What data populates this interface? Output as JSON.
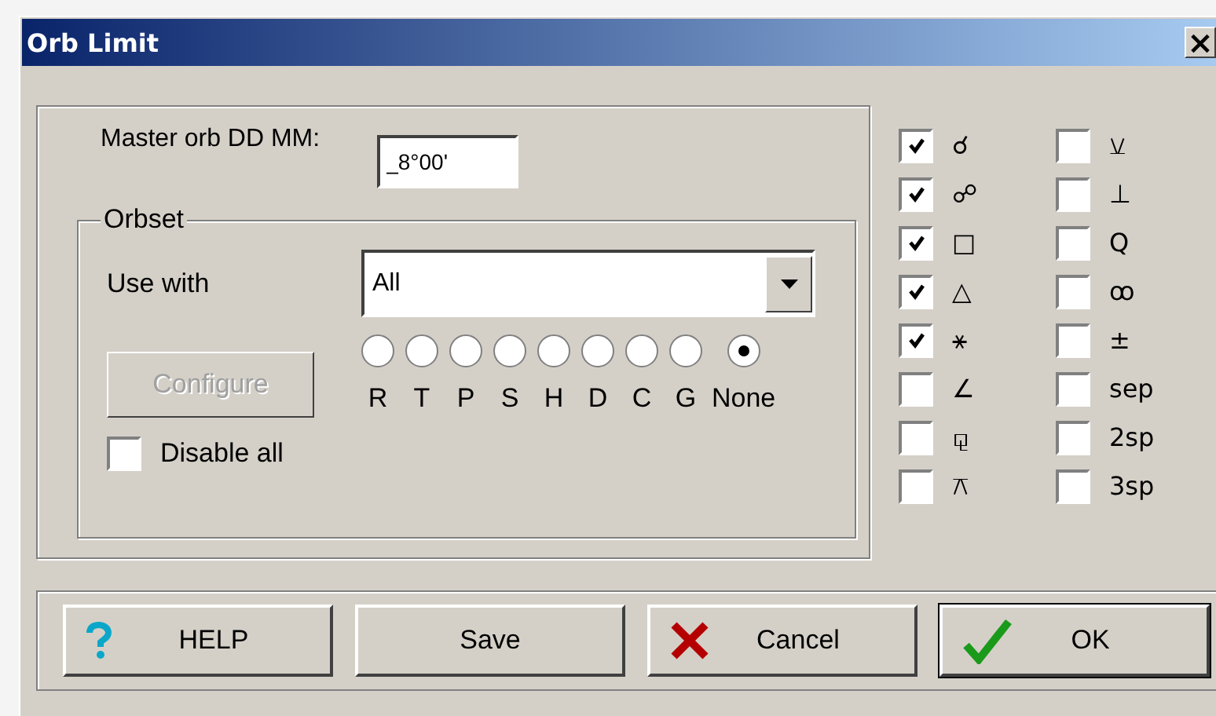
{
  "window": {
    "title": "Orb Limit",
    "close": "×"
  },
  "master_orb": {
    "label": "Master orb DD MM:",
    "value": "_8°00'"
  },
  "orbset": {
    "title": "Orbset",
    "use_with_label": "Use with",
    "use_with_value": "All",
    "configure": {
      "label": "Configure",
      "disabled": true
    },
    "radios": [
      {
        "label": "R",
        "selected": false
      },
      {
        "label": "T",
        "selected": false
      },
      {
        "label": "P",
        "selected": false
      },
      {
        "label": "S",
        "selected": false
      },
      {
        "label": "H",
        "selected": false
      },
      {
        "label": "D",
        "selected": false
      },
      {
        "label": "C",
        "selected": false
      },
      {
        "label": "G",
        "selected": false
      },
      {
        "label": "None",
        "selected": true
      }
    ],
    "disable_all": {
      "label": "Disable all",
      "checked": false
    }
  },
  "aspects": [
    {
      "symbol": "☌",
      "checked": true
    },
    {
      "symbol": "☍",
      "checked": true
    },
    {
      "symbol": "□",
      "checked": true
    },
    {
      "symbol": "△",
      "checked": true
    },
    {
      "symbol": "⚹",
      "checked": true
    },
    {
      "symbol": "∠",
      "checked": false
    },
    {
      "symbol": "⚼",
      "checked": false
    },
    {
      "symbol": "⚻",
      "checked": false
    },
    {
      "symbol": "⚺",
      "checked": false
    },
    {
      "symbol": "⊥",
      "checked": false
    },
    {
      "symbol": "Q",
      "checked": false
    },
    {
      "symbol": "ꝏ",
      "checked": false
    },
    {
      "symbol": "±",
      "checked": false
    },
    {
      "symbol": "sep",
      "checked": false
    },
    {
      "symbol": "2sp",
      "checked": false
    },
    {
      "symbol": "3sp",
      "checked": false
    }
  ],
  "buttons": [
    {
      "kind": "help",
      "label": "HELP"
    },
    {
      "kind": "save",
      "label": "Save"
    },
    {
      "kind": "cancel",
      "label": "Cancel"
    },
    {
      "kind": "ok",
      "label": "OK"
    }
  ]
}
